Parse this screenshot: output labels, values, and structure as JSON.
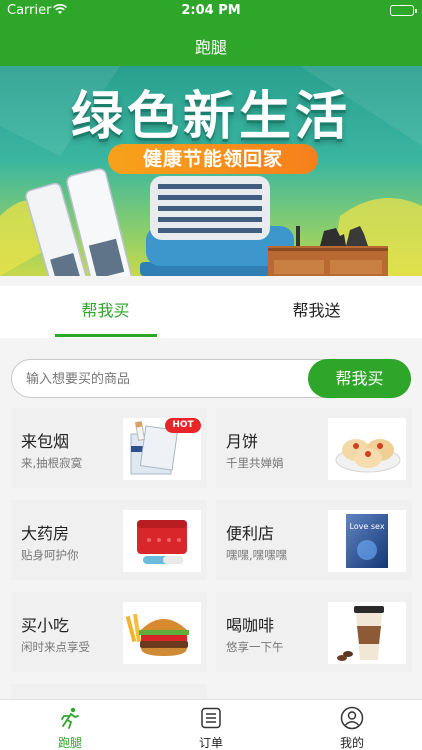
{
  "status_bar": {
    "carrier": "Carrier",
    "time": "2:04 PM"
  },
  "nav": {
    "title": "跑腿"
  },
  "banner": {
    "headline": "绿色新生活",
    "subline": "健康节能领回家"
  },
  "tabs": [
    {
      "label": "帮我买",
      "active": true
    },
    {
      "label": "帮我送",
      "active": false
    }
  ],
  "search": {
    "placeholder": "输入想要买的商品",
    "button_label": "帮我买"
  },
  "categories": [
    {
      "name": "来包烟",
      "desc": "来,抽根寂寞",
      "icon": "cigarette-pack",
      "badge": "HOT"
    },
    {
      "name": "月饼",
      "desc": "千里共婵娟",
      "icon": "mooncake"
    },
    {
      "name": "大药房",
      "desc": "贴身呵护你",
      "icon": "medicine-box"
    },
    {
      "name": "便利店",
      "desc": "嘿嘿,嘿嘿嘿",
      "icon": "convenience-product",
      "thumb_text": "Love sex"
    },
    {
      "name": "买小吃",
      "desc": "闲时来点享受",
      "icon": "burger"
    },
    {
      "name": "喝咖啡",
      "desc": "悠享一下午",
      "icon": "coffee-cup"
    }
  ],
  "tabbar": [
    {
      "label": "跑腿",
      "icon": "runner-icon",
      "active": true
    },
    {
      "label": "订单",
      "icon": "order-list-icon",
      "active": false
    },
    {
      "label": "我的",
      "icon": "user-icon",
      "active": false
    }
  ],
  "colors": {
    "brand_green": "#2ea62a",
    "accent_orange": "#f6801b",
    "hot_red": "#e8262a"
  }
}
